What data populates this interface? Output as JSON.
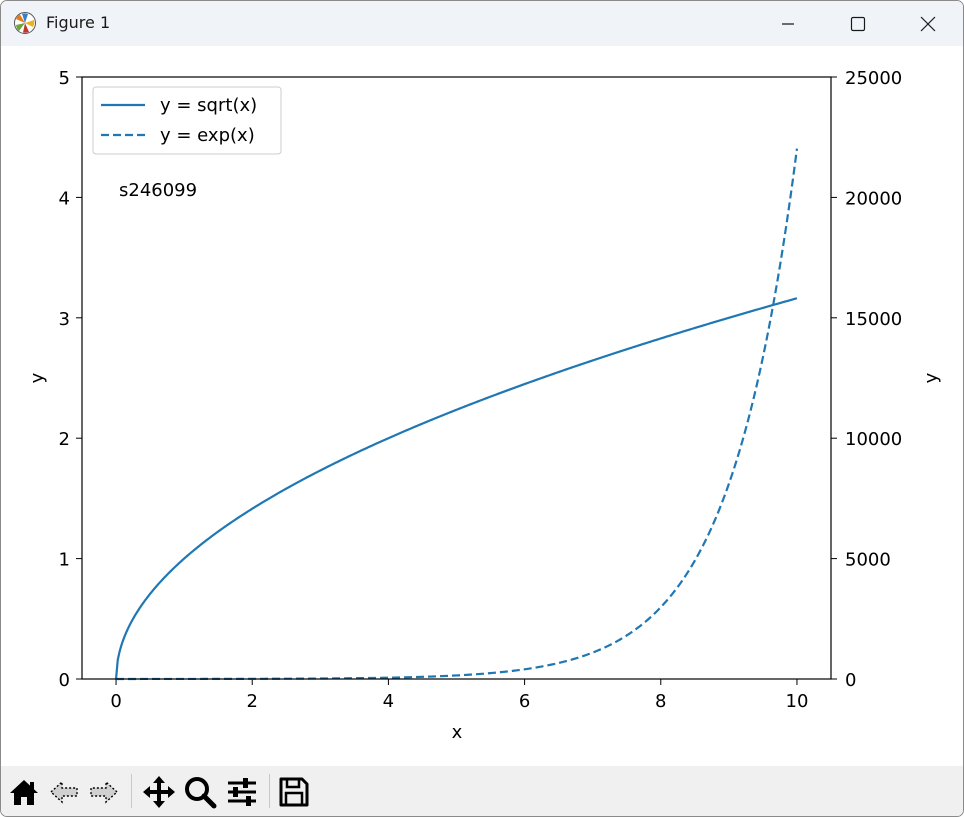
{
  "window": {
    "title": "Figure 1"
  },
  "toolbar": {
    "buttons": [
      {
        "name": "home",
        "icon": "home-icon"
      },
      {
        "name": "back",
        "icon": "arrow-left-icon"
      },
      {
        "name": "forward",
        "icon": "arrow-right-icon"
      },
      {
        "name": "pan",
        "icon": "move-icon"
      },
      {
        "name": "zoom",
        "icon": "magnifier-icon"
      },
      {
        "name": "configure",
        "icon": "sliders-icon"
      },
      {
        "name": "save",
        "icon": "floppy-disk-icon"
      }
    ]
  },
  "chart_data": {
    "type": "line",
    "title": "",
    "xlabel": "x",
    "ylabel": "y",
    "ylabel_right": "y",
    "annotation": "s246099",
    "xlim": [
      -0.5,
      10.5
    ],
    "ylim": [
      0,
      5
    ],
    "ylim_right": [
      0,
      25000
    ],
    "x_ticks": [
      "0",
      "2",
      "4",
      "6",
      "8",
      "10"
    ],
    "y_ticks": [
      "0",
      "1",
      "2",
      "3",
      "4",
      "5"
    ],
    "y_right_ticks": [
      "0",
      "5000",
      "10000",
      "15000",
      "20000",
      "25000"
    ],
    "legend_position": "top-left",
    "series": [
      {
        "name": "y = sqrt(x)",
        "function": "sqrt",
        "axis": "left",
        "style": "solid",
        "x_range": [
          0,
          10
        ]
      },
      {
        "name": "y = exp(x)",
        "function": "exp",
        "axis": "right",
        "style": "dashed",
        "x_range": [
          0,
          10
        ]
      }
    ],
    "colors": {
      "line": "#1f77b4"
    },
    "grid": false
  }
}
